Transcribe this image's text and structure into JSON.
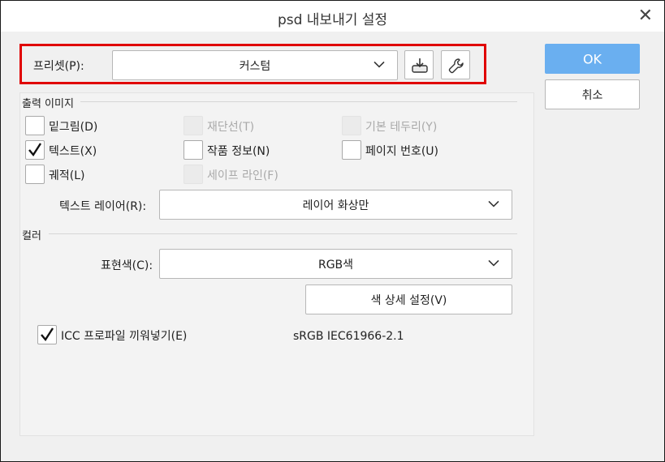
{
  "window": {
    "title": "psd 내보내기 설정",
    "close_glyph": "✕"
  },
  "preset": {
    "label": "프리셋(P):",
    "value": "커스텀",
    "save_icon": "save-preset-icon",
    "settings_icon": "wrench-icon"
  },
  "output_section": {
    "title": "출력 이미지",
    "checkboxes": [
      {
        "label": "밑그림(D)",
        "checked": false,
        "enabled": true
      },
      {
        "label": "재단선(T)",
        "checked": false,
        "enabled": false
      },
      {
        "label": "기본 테두리(Y)",
        "checked": false,
        "enabled": false
      },
      {
        "label": "텍스트(X)",
        "checked": true,
        "enabled": true
      },
      {
        "label": "작품 정보(N)",
        "checked": false,
        "enabled": true
      },
      {
        "label": "페이지 번호(U)",
        "checked": false,
        "enabled": true
      },
      {
        "label": "궤적(L)",
        "checked": false,
        "enabled": true
      },
      {
        "label": "세이프 라인(F)",
        "checked": false,
        "enabled": false
      }
    ],
    "text_layer_label": "텍스트 레이어(R):",
    "text_layer_value": "레이어 화상만"
  },
  "color_section": {
    "title": "컬러",
    "expression_label": "표현색(C):",
    "expression_value": "RGB색",
    "detail_button": "색 상세 설정(V)",
    "icc_label": "ICC 프로파일 끼워넣기(E)",
    "icc_checked": true,
    "icc_profile": "sRGB IEC61966-2.1"
  },
  "buttons": {
    "ok": "OK",
    "cancel": "취소"
  },
  "colors": {
    "accent": "#6aaff0",
    "highlight": "#e00000"
  }
}
